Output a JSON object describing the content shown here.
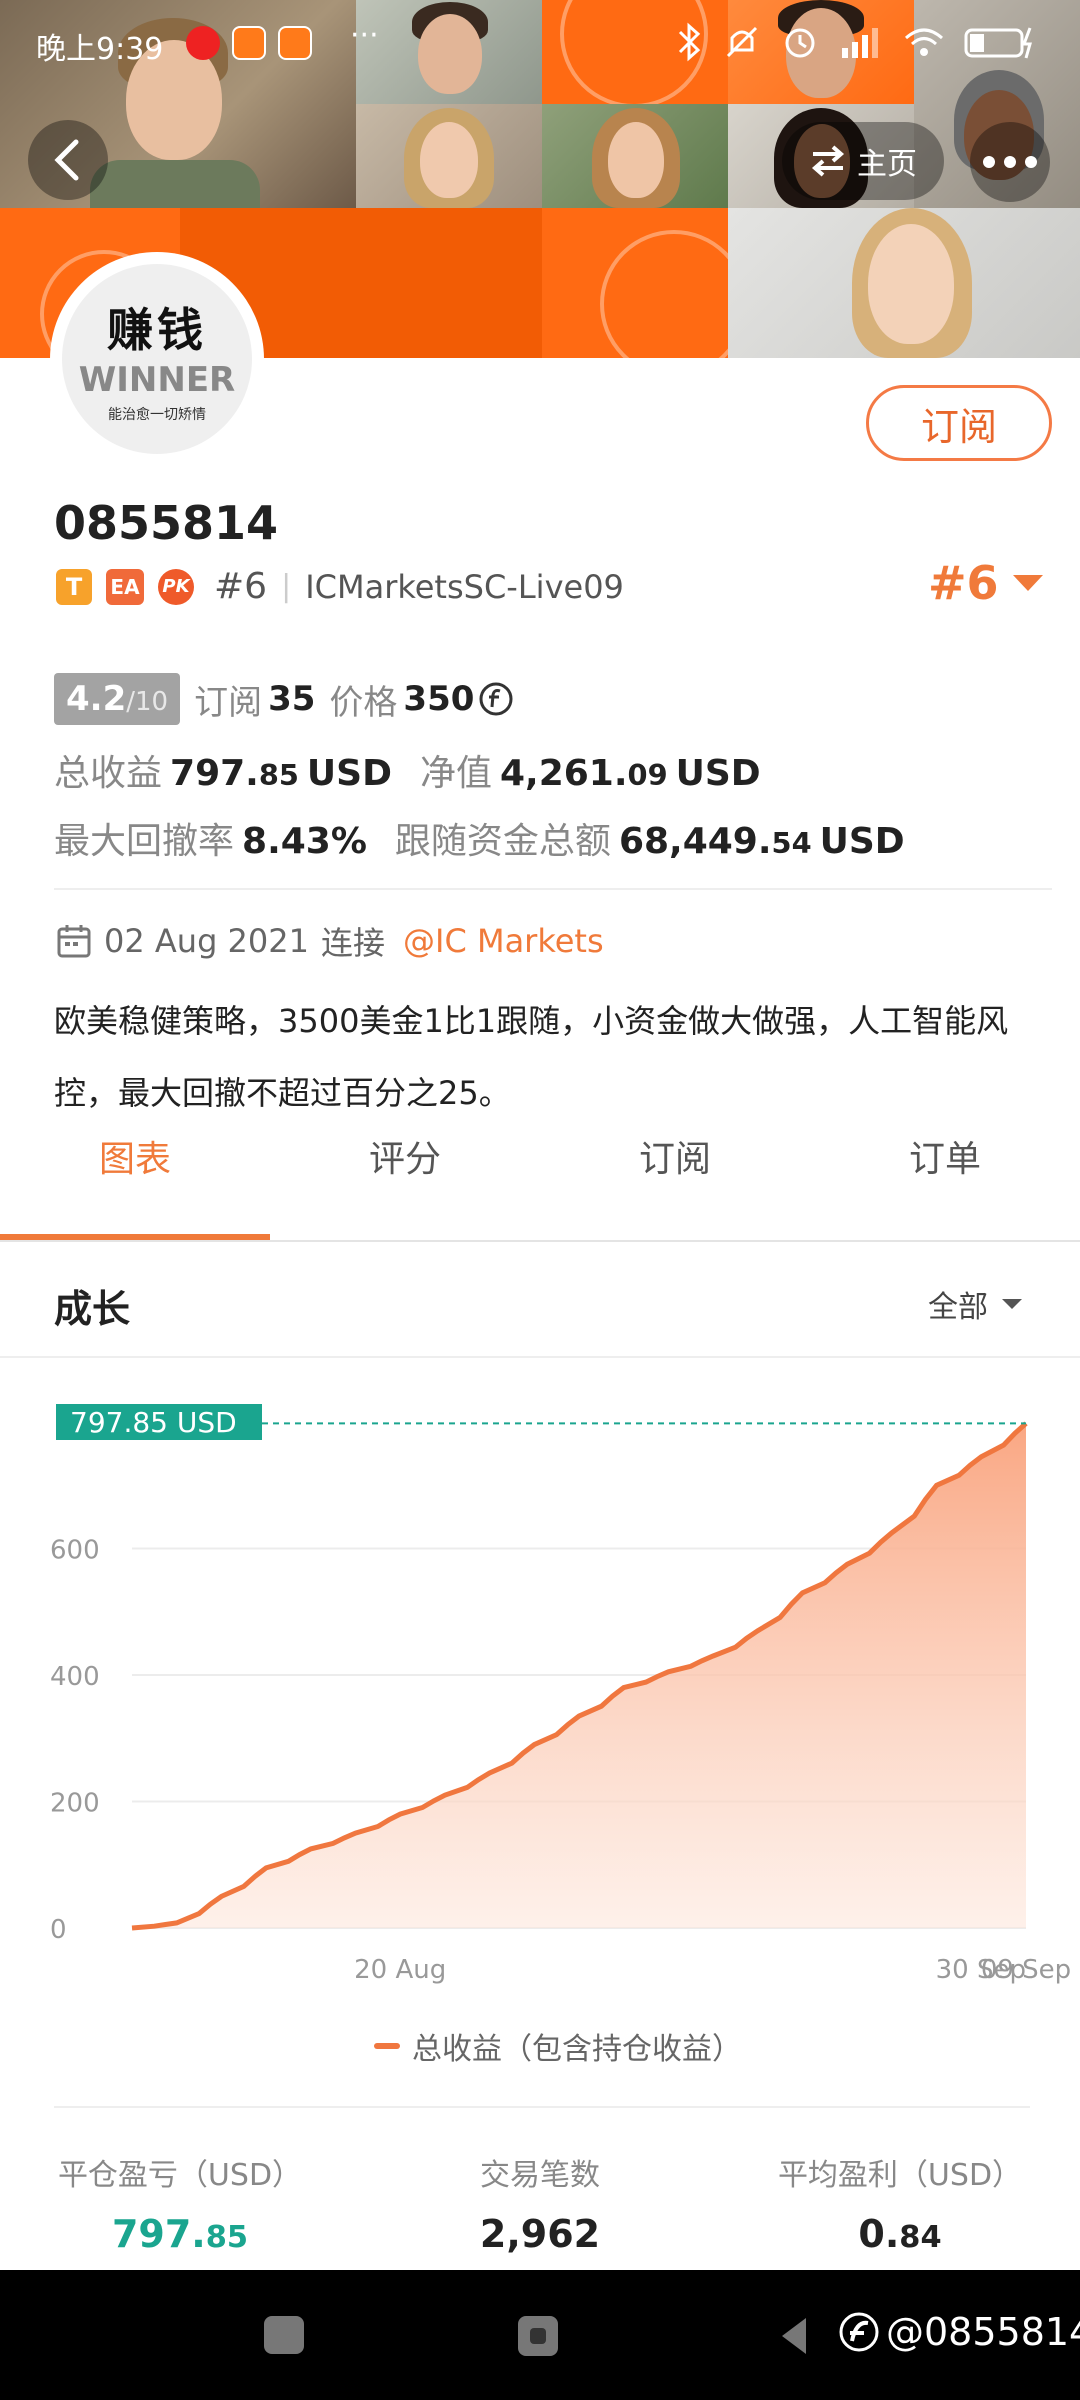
{
  "status_bar": {
    "time": "晚上9:39",
    "dots": "···"
  },
  "nav": {
    "home_label": "主页"
  },
  "avatar": {
    "line1": "赚钱",
    "line2": "WINNER",
    "line3": "能治愈一切矫情"
  },
  "profile": {
    "subscribe_label": "订阅",
    "name": "0855814",
    "rank_inline": "#6",
    "server": "ICMarketsSC-Live09",
    "rank_big": "#6",
    "badges": {
      "t": "T",
      "ea": "EA",
      "pk": "PK"
    }
  },
  "stats": {
    "rating": "4.2",
    "rating_max": "/10",
    "subscribe_label": "订阅",
    "subscribe_count": "35",
    "price_label": "价格",
    "price": "350",
    "total_profit_label": "总收益",
    "total_profit_int": "797.",
    "total_profit_dec": "85",
    "total_profit_unit": "USD",
    "equity_label": "净值",
    "equity_int": "4,261.",
    "equity_dec": "09",
    "equity_unit": "USD",
    "drawdown_label": "最大回撤率",
    "drawdown": "8.43%",
    "follow_label": "跟随资金总额",
    "follow_int": "68,449.",
    "follow_dec": "54",
    "follow_unit": "USD"
  },
  "connect": {
    "date": "02 Aug 2021",
    "connect_label": "连接",
    "broker": "@IC Markets"
  },
  "description": "欧美稳健策略，3500美金1比1跟随，小资金做大做强，人工智能风控，最大回撤不超过百分之25。",
  "tabs": [
    "图表",
    "评分",
    "订阅",
    "订单"
  ],
  "section": {
    "title": "成长",
    "filter": "全部"
  },
  "chart_data": {
    "type": "area",
    "ylim": [
      0,
      800
    ],
    "yticks": [
      "0",
      "200",
      "400",
      "600"
    ],
    "xticks": [
      "20 Aug",
      "09 Sep",
      "30 Sep"
    ],
    "current_label": "797.85 USD",
    "legend": "总收益（包含持仓收益）",
    "series": [
      {
        "name": "总收益（包含持仓收益）",
        "x": [
          "02 Aug",
          "05 Aug",
          "08 Aug",
          "11 Aug",
          "14 Aug",
          "17 Aug",
          "20 Aug",
          "23 Aug",
          "26 Aug",
          "29 Aug",
          "01 Sep",
          "04 Sep",
          "07 Sep",
          "10 Sep",
          "13 Sep",
          "16 Sep",
          "19 Sep",
          "22 Sep",
          "25 Sep",
          "28 Sep",
          "30 Sep"
        ],
        "values": [
          0,
          8,
          50,
          95,
          125,
          150,
          180,
          210,
          245,
          290,
          335,
          380,
          405,
          430,
          470,
          530,
          575,
          625,
          700,
          745,
          797.85
        ]
      }
    ]
  },
  "bottom_stats": [
    {
      "label": "平仓盈亏（USD）",
      "int": "797.",
      "dec": "85"
    },
    {
      "label": "交易笔数",
      "int": "2,962",
      "dec": ""
    },
    {
      "label": "平均盈利（USD）",
      "int": "0.",
      "dec": "84"
    }
  ],
  "watermark": "@0855814",
  "colors": {
    "accent": "#f47a45",
    "teal": "#1aa58f",
    "banner": "#ff6a13"
  }
}
